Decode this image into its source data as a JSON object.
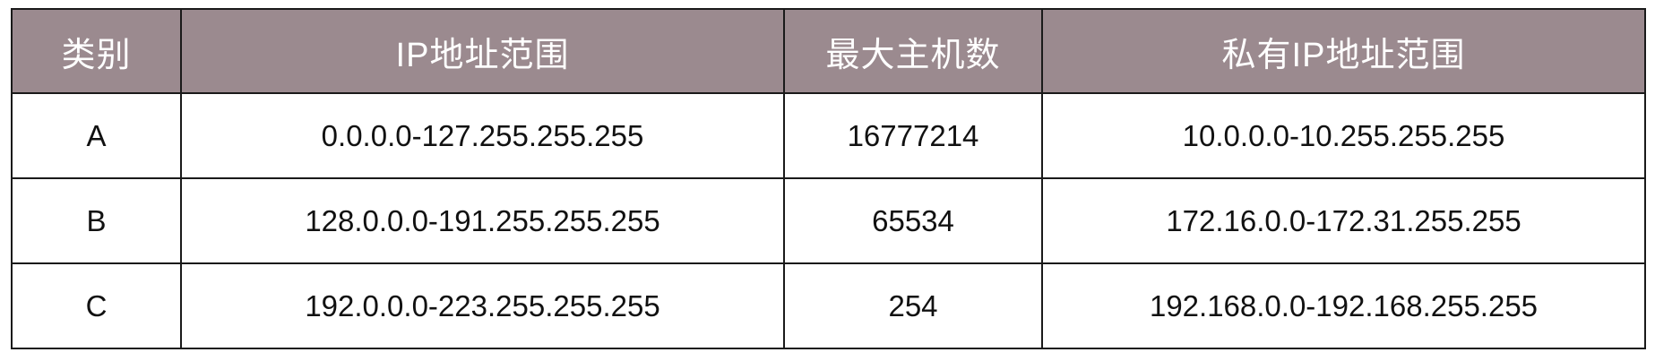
{
  "table": {
    "headers": [
      "类别",
      "IP地址范围",
      "最大主机数",
      "私有IP地址范围"
    ],
    "rows": [
      [
        "A",
        "0.0.0.0-127.255.255.255",
        "16777214",
        "10.0.0.0-10.255.255.255"
      ],
      [
        "B",
        "128.0.0.0-191.255.255.255",
        "65534",
        "172.16.0.0-172.31.255.255"
      ],
      [
        "C",
        "192.0.0.0-223.255.255.255",
        "254",
        "192.168.0.0-192.168.255.255"
      ]
    ]
  },
  "colors": {
    "header_background": "#9b8a8f",
    "header_text": "#ffffff",
    "border": "#1a1a1a",
    "cell_text": "#111111"
  }
}
